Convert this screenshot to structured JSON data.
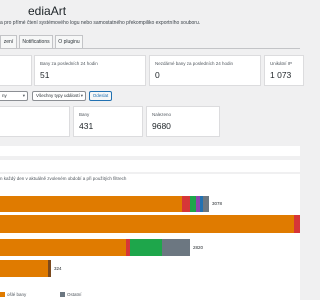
{
  "header": {
    "title": "ediaArt",
    "subtitle": "a pro přímé čtení systémového logu nebo samostatného překompiliko exportního souboru."
  },
  "tabs": [
    {
      "label": "zení"
    },
    {
      "label": "Notifications"
    },
    {
      "label": "O pluginu"
    }
  ],
  "stats_row1": [
    {
      "label": "",
      "value": ""
    },
    {
      "label": "Bany za posledních 24 hodin",
      "value": "51"
    },
    {
      "label": "Nezdárné bany za posledních 24 hodin",
      "value": "0"
    },
    {
      "label": "Unikátní IP",
      "value": "1 073"
    }
  ],
  "filters": {
    "select1": "ny",
    "select2": "Všechny typy událostí",
    "button": "Odeslat"
  },
  "stats_row2": [
    {
      "label": "",
      "value": ""
    },
    {
      "label": "Bany",
      "value": "431"
    },
    {
      "label": "Nalezeno",
      "value": "9680"
    }
  ],
  "chart_caption": "n každý den v aktuálně zvoleném období a při použitých filtrech",
  "colors": {
    "orange": "#e07b00",
    "red": "#d63638",
    "green": "#1ea64b",
    "purple": "#8e44ad",
    "blue": "#2271b1",
    "gray": "#6c7781",
    "brown": "#7b4a1e"
  },
  "chart_data": {
    "type": "bar",
    "orientation": "horizontal",
    "stacked": true,
    "rows": [
      {
        "total_label": "3078",
        "segments": [
          {
            "color": "orange",
            "value": 182
          },
          {
            "color": "red",
            "value": 8
          },
          {
            "color": "green",
            "value": 6
          },
          {
            "color": "purple",
            "value": 4
          },
          {
            "color": "blue",
            "value": 3
          },
          {
            "color": "gray",
            "value": 6
          }
        ]
      },
      {
        "total_label": "",
        "segments": [
          {
            "color": "orange",
            "value": 294
          },
          {
            "color": "red",
            "value": 6
          }
        ]
      },
      {
        "total_label": "2820",
        "segments": [
          {
            "color": "orange",
            "value": 126
          },
          {
            "color": "red",
            "value": 4
          },
          {
            "color": "green",
            "value": 32
          },
          {
            "color": "gray",
            "value": 28
          }
        ]
      },
      {
        "total_label": "324",
        "segments": [
          {
            "color": "orange",
            "value": 48
          },
          {
            "color": "brown",
            "value": 3
          }
        ]
      }
    ]
  },
  "legend": [
    {
      "label": "ošlé bany",
      "color": "orange"
    },
    {
      "label": "Ostatní",
      "color": "gray"
    }
  ]
}
